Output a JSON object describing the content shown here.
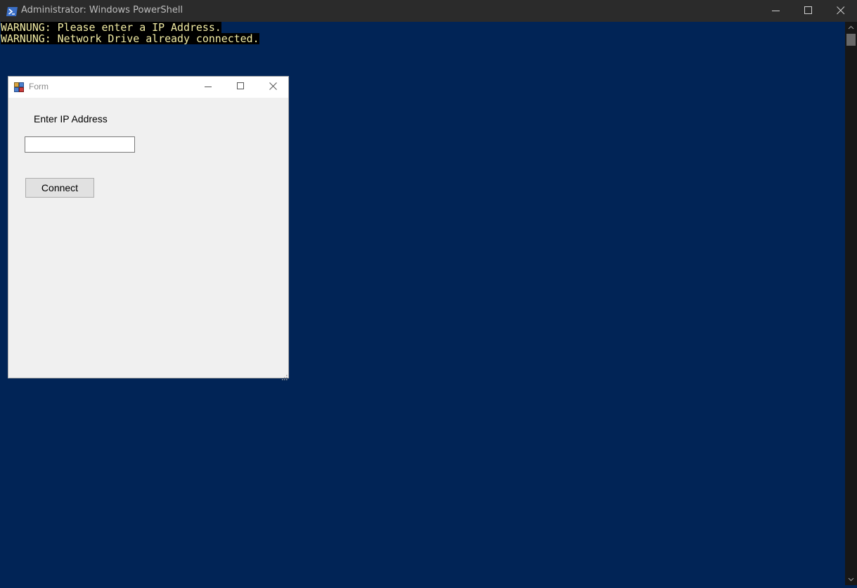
{
  "window": {
    "title": "Administrator: Windows PowerShell",
    "background_color": "#012456",
    "titlebar_color": "#2b2b2b"
  },
  "console": {
    "lines": [
      "WARNUNG: Please enter a IP Address.",
      "WARNUNG: Network Drive already connected."
    ],
    "warning_text_color": "#f2eca4",
    "warning_background_color": "#000000"
  },
  "form": {
    "title": "Form",
    "label": "Enter IP Address",
    "input": {
      "value": "",
      "placeholder": ""
    },
    "button_label": "Connect",
    "background_color": "#f0f0f0"
  },
  "icons": {
    "powershell": "powershell-icon",
    "form": "form-app-icon",
    "minimize": "minimize-icon",
    "maximize": "maximize-icon",
    "close": "close-icon",
    "scroll_up": "scroll-up-arrow-icon",
    "scroll_down": "scroll-down-arrow-icon",
    "size_grip": "resize-grip-icon"
  }
}
